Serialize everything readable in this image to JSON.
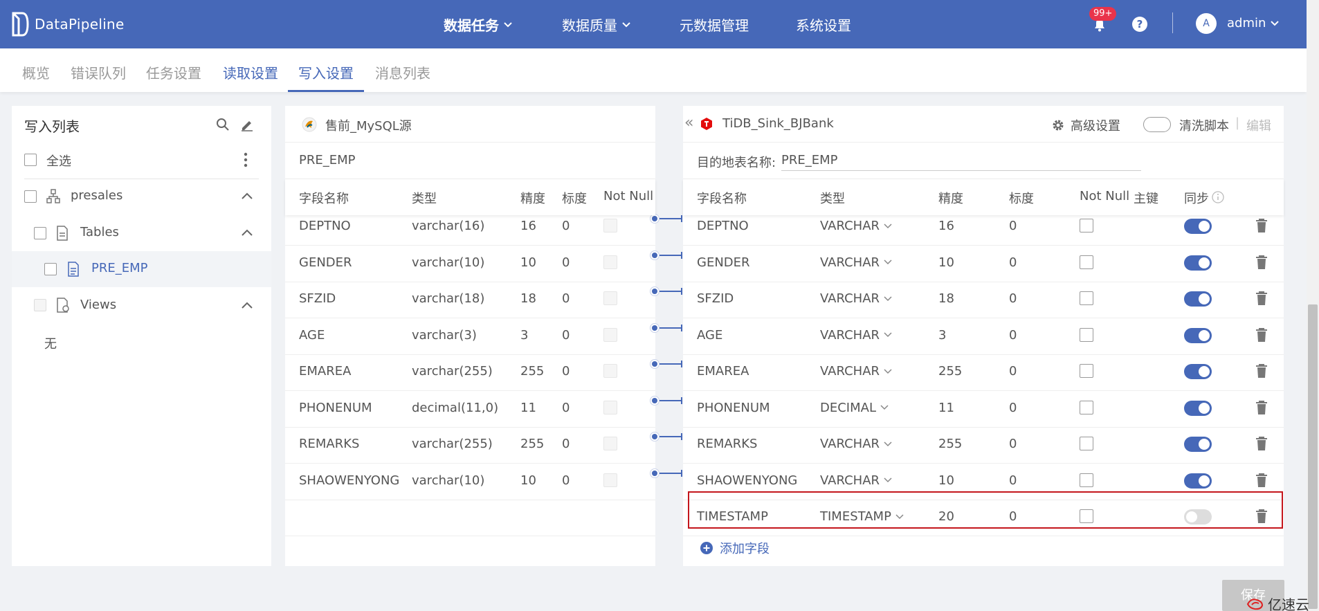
{
  "app": {
    "name": "DataPipeline"
  },
  "topnav": {
    "items": [
      {
        "label": "数据任务"
      },
      {
        "label": "数据质量"
      },
      {
        "label": "元数据管理"
      },
      {
        "label": "系统设置"
      }
    ],
    "badge": "99+",
    "help": "?",
    "avatar_letter": "A",
    "user": "admin"
  },
  "subtabs": [
    "概览",
    "错误队列",
    "任务设置",
    "读取设置",
    "写入设置",
    "消息列表"
  ],
  "left": {
    "title": "写入列表",
    "select_all": "全选",
    "schema": "presales",
    "tables_label": "Tables",
    "table_item": "PRE_EMP",
    "views_label": "Views",
    "empty": "无"
  },
  "source": {
    "name": "售前_MySQL源",
    "table": "PRE_EMP",
    "columns": [
      "字段名称",
      "类型",
      "精度",
      "标度",
      "Not Null"
    ],
    "rows": [
      {
        "name": "DEPTNO",
        "type": "varchar(16)",
        "precision": "16",
        "scale": "0"
      },
      {
        "name": "GENDER",
        "type": "varchar(10)",
        "precision": "10",
        "scale": "0"
      },
      {
        "name": "SFZID",
        "type": "varchar(18)",
        "precision": "18",
        "scale": "0"
      },
      {
        "name": "AGE",
        "type": "varchar(3)",
        "precision": "3",
        "scale": "0"
      },
      {
        "name": "EMAREA",
        "type": "varchar(255)",
        "precision": "255",
        "scale": "0"
      },
      {
        "name": "PHONENUM",
        "type": "decimal(11,0)",
        "precision": "11",
        "scale": "0"
      },
      {
        "name": "REMARKS",
        "type": "varchar(255)",
        "precision": "255",
        "scale": "0"
      },
      {
        "name": "SHAOWENYONG",
        "type": "varchar(10)",
        "precision": "10",
        "scale": "0"
      }
    ]
  },
  "dest": {
    "collapse": "«",
    "name": "TiDB_Sink_BJBank",
    "advanced": "高级设置",
    "clean_script": "清洗脚本",
    "divider": "|",
    "edit": "编辑",
    "table_label": "目的地表名称:",
    "table_value": "PRE_EMP",
    "columns": [
      "字段名称",
      "类型",
      "精度",
      "标度",
      "Not Null",
      "主键",
      "同步"
    ],
    "rows": [
      {
        "name": "DEPTNO",
        "type": "VARCHAR",
        "precision": "16",
        "scale": "0",
        "sync": true
      },
      {
        "name": "GENDER",
        "type": "VARCHAR",
        "precision": "10",
        "scale": "0",
        "sync": true
      },
      {
        "name": "SFZID",
        "type": "VARCHAR",
        "precision": "18",
        "scale": "0",
        "sync": true
      },
      {
        "name": "AGE",
        "type": "VARCHAR",
        "precision": "3",
        "scale": "0",
        "sync": true
      },
      {
        "name": "EMAREA",
        "type": "VARCHAR",
        "precision": "255",
        "scale": "0",
        "sync": true
      },
      {
        "name": "PHONENUM",
        "type": "DECIMAL",
        "precision": "11",
        "scale": "0",
        "sync": true
      },
      {
        "name": "REMARKS",
        "type": "VARCHAR",
        "precision": "255",
        "scale": "0",
        "sync": true
      },
      {
        "name": "SHAOWENYONG",
        "type": "VARCHAR",
        "precision": "10",
        "scale": "0",
        "sync": true
      },
      {
        "name": "TIMESTAMP",
        "type": "TIMESTAMP",
        "precision": "20",
        "scale": "0",
        "sync": false
      }
    ],
    "add_field": "添加字段"
  },
  "save_label": "保存",
  "watermark": "亿速云",
  "colors": {
    "primary": "#4668b8",
    "highlight": "#c4161c",
    "badge": "#e9344b"
  }
}
